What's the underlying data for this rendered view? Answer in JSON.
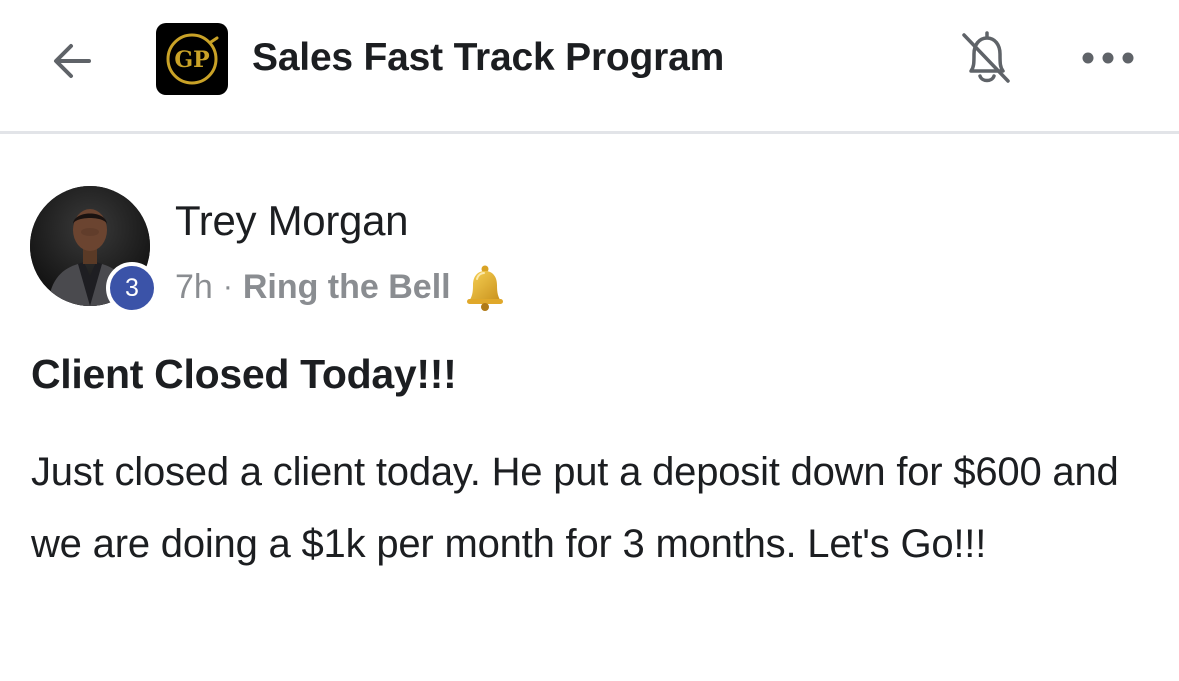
{
  "header": {
    "back_icon": "arrow-left-icon",
    "group_logo_text": "GP",
    "group_name": "Sales Fast Track Program",
    "notifications_icon": "bell-off-icon",
    "more_icon": "more-horizontal-icon"
  },
  "post": {
    "author": {
      "name": "Trey Morgan",
      "level_badge": "3"
    },
    "time": "7h",
    "separator": "·",
    "topic": "Ring the Bell",
    "topic_icon": "bell-emoji",
    "title": "Client Closed Today!!!",
    "body": "Just closed a client today. He put a deposit down for $600 and we are doing a $1k per month for 3 months. Let's Go!!!"
  },
  "colors": {
    "text_primary": "#1c1e21",
    "text_secondary": "#8a8d91",
    "badge_blue": "#3b53a8",
    "logo_gold": "#c9a227",
    "divider": "#e2e4e8"
  }
}
